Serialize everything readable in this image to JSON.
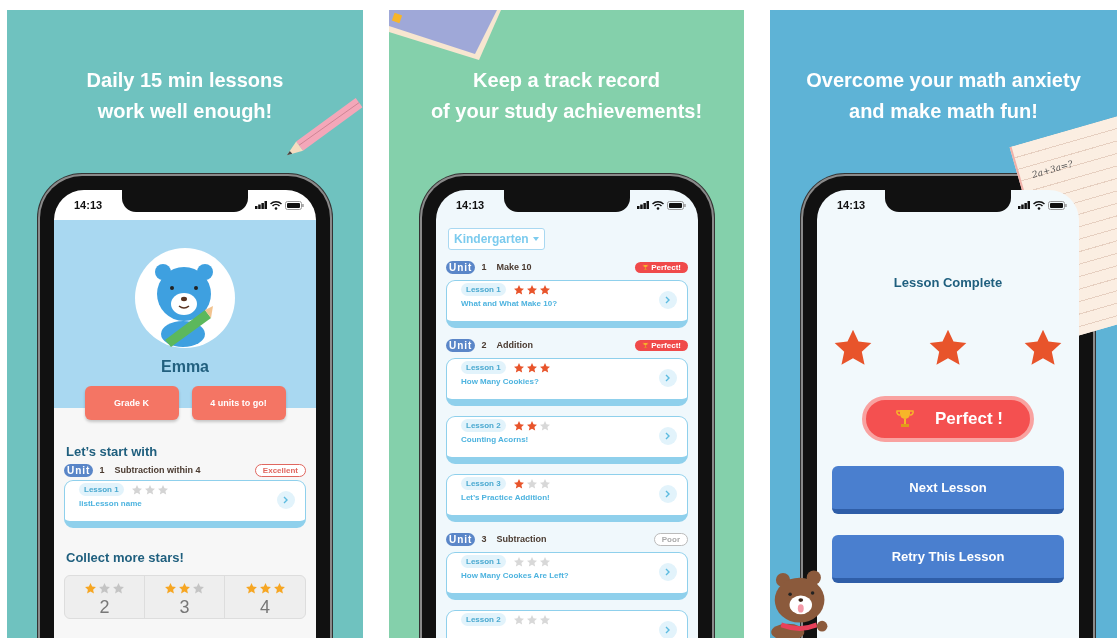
{
  "panels": [
    {
      "kind": "profile",
      "headline": [
        "Daily 15 min lessons",
        "work well enough!"
      ],
      "status_time": "14:13",
      "screen": {
        "name": "Emma",
        "buttons": [
          "Grade K",
          "4 units to go!"
        ],
        "start_heading": "Let’s start with",
        "unit": {
          "logo": "Unit",
          "number": "1",
          "name": "Subtraction within 4",
          "badge": {
            "kind": "excellent",
            "text": "Excellent"
          }
        },
        "lesson": {
          "tag": "Lesson 1",
          "stars": 0,
          "title": "listLesson name"
        },
        "collect_heading": "Collect more stars!",
        "star_goals": [
          {
            "stars": 1,
            "count": "2"
          },
          {
            "stars": 2,
            "count": "3"
          },
          {
            "stars": 3,
            "count": "4"
          }
        ]
      }
    },
    {
      "kind": "units",
      "headline": [
        "Keep a track record",
        "of your study achievements!"
      ],
      "status_time": "14:13",
      "screen": {
        "grade": "Kindergarten",
        "units": [
          {
            "logo": "Unit",
            "number": "1",
            "name": "Make 10",
            "badge": {
              "kind": "perfect",
              "text": "Perfect!"
            },
            "lessons": [
              {
                "tag": "Lesson 1",
                "stars": 3,
                "title": "What and What Make 10?"
              }
            ]
          },
          {
            "logo": "Unit",
            "number": "2",
            "name": "Addition",
            "badge": {
              "kind": "perfect",
              "text": "Perfect!"
            },
            "lessons": [
              {
                "tag": "Lesson 1",
                "stars": 3,
                "title": "How Many Cookies?"
              },
              {
                "tag": "Lesson 2",
                "stars": 2,
                "title": "Counting Acorns!"
              },
              {
                "tag": "Lesson 3",
                "stars": 1,
                "title": "Let’s Practice Addition!"
              }
            ]
          },
          {
            "logo": "Unit",
            "number": "3",
            "name": "Subtraction",
            "badge": {
              "kind": "poor",
              "text": "Poor"
            },
            "lessons": [
              {
                "tag": "Lesson 1",
                "stars": 0,
                "title": "How Many Cookes Are Left?"
              },
              {
                "tag": "Lesson 2",
                "stars": 0
              }
            ]
          }
        ]
      }
    },
    {
      "kind": "complete",
      "headline": [
        "Overcome your math anxiety",
        "and make math fun!"
      ],
      "status_time": "14:13",
      "paper_note": "2a+3a=?",
      "screen": {
        "title": "Lesson Complete",
        "stars": 3,
        "result": "Perfect !",
        "buttons": [
          "Next Lesson",
          "Retry This Lesson"
        ]
      }
    }
  ]
}
